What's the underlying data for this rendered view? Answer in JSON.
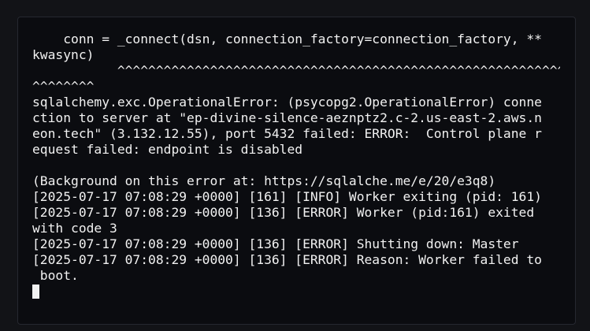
{
  "terminal": {
    "lines": [
      "    conn = _connect(dsn, connection_factory=connection_factory, **",
      "kwasync)",
      "           ^^^^^^^^^^^^^^^^^^^^^^^^^^^^^^^^^^^^^^^^^^^^^^^^^^^^^^^^^^^",
      "^^^^^^^^",
      "sqlalchemy.exc.OperationalError: (psycopg2.OperationalError) conne",
      "ction to server at \"ep-divine-silence-aeznptz2.c-2.us-east-2.aws.n",
      "eon.tech\" (3.132.12.55), port 5432 failed: ERROR:  Control plane r",
      "equest failed: endpoint is disabled",
      "",
      "(Background on this error at: https://sqlalche.me/e/20/e3q8)",
      "[2025-07-17 07:08:29 +0000] [161] [INFO] Worker exiting (pid: 161)",
      "[2025-07-17 07:08:29 +0000] [136] [ERROR] Worker (pid:161) exited",
      "with code 3",
      "[2025-07-17 07:08:29 +0000] [136] [ERROR] Shutting down: Master",
      "[2025-07-17 07:08:29 +0000] [136] [ERROR] Reason: Worker failed to",
      " boot."
    ]
  }
}
